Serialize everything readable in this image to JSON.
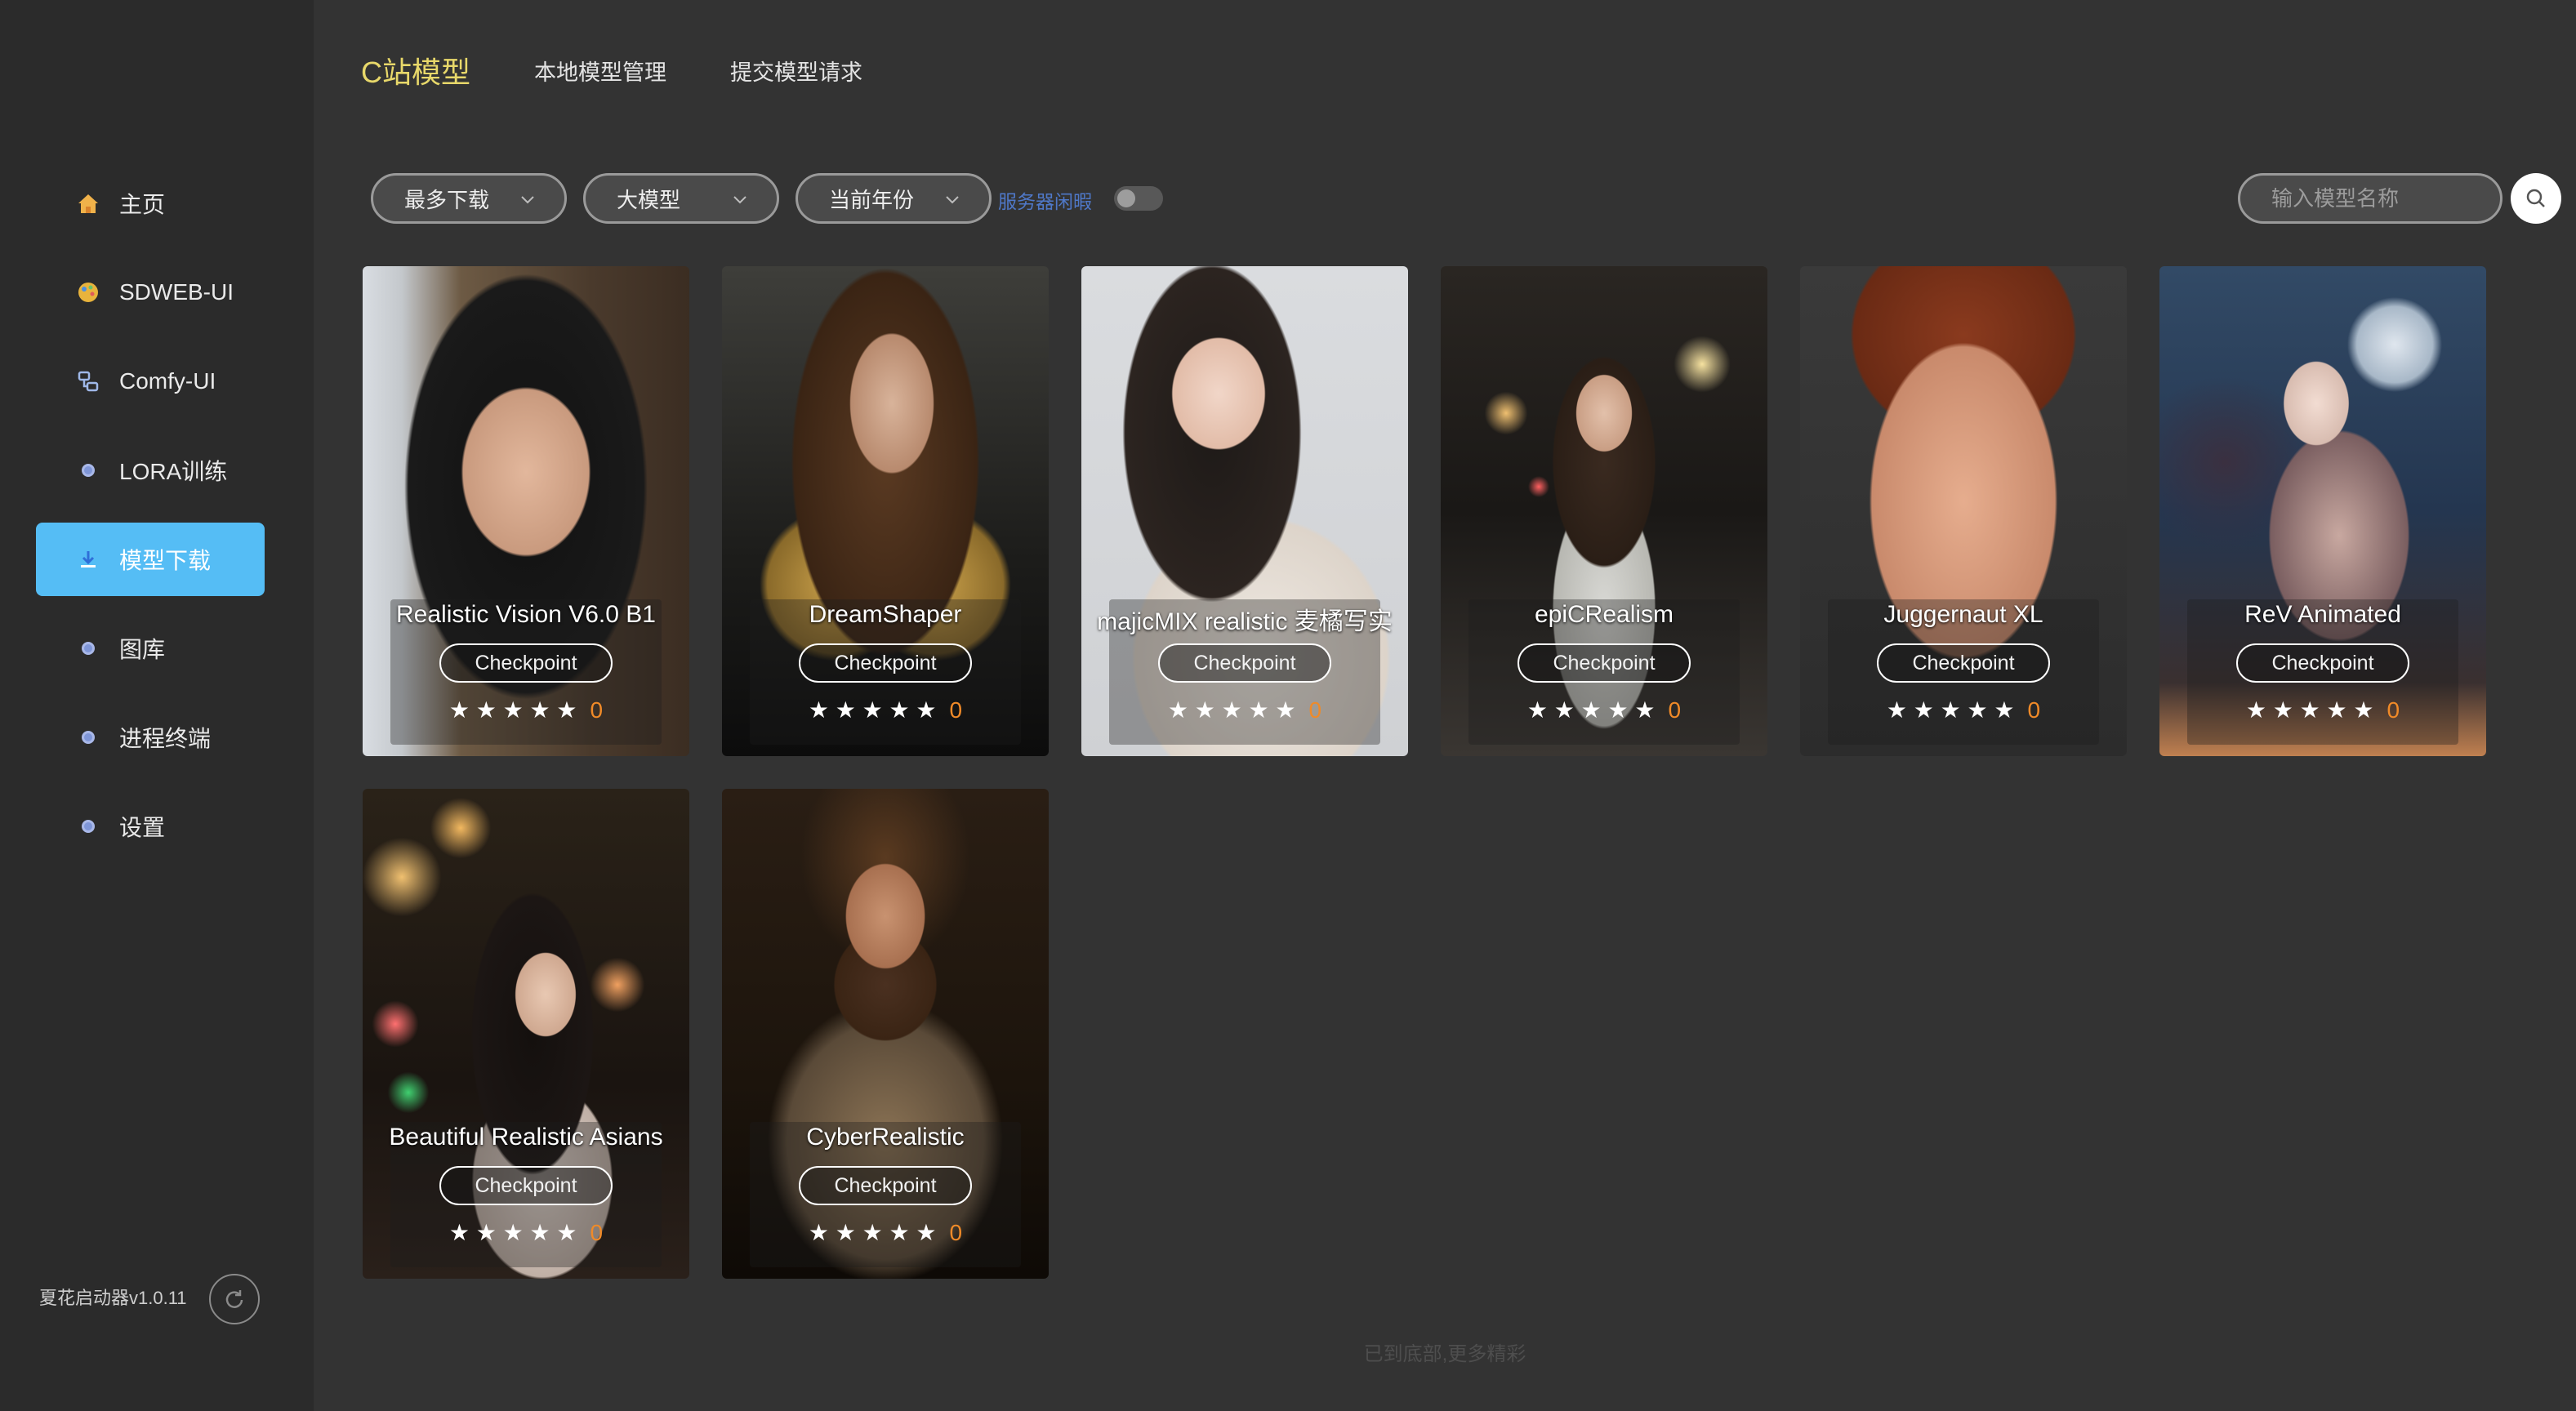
{
  "sidebar": {
    "items": [
      {
        "label": "主页",
        "icon": "home-icon",
        "active": false
      },
      {
        "label": "SDWEB-UI",
        "icon": "palette-icon",
        "active": false
      },
      {
        "label": "Comfy-UI",
        "icon": "workflow-icon",
        "active": false
      },
      {
        "label": "LORA训练",
        "icon": "dot-icon",
        "active": false
      },
      {
        "label": "模型下载",
        "icon": "download-icon",
        "active": true
      },
      {
        "label": "图库",
        "icon": "dot-icon",
        "active": false
      },
      {
        "label": "进程终端",
        "icon": "dot-icon",
        "active": false
      },
      {
        "label": "设置",
        "icon": "dot-icon",
        "active": false
      }
    ],
    "version": "夏花启动器v1.0.11"
  },
  "tabs": [
    {
      "label": "C站模型",
      "active": true
    },
    {
      "label": "本地模型管理",
      "active": false
    },
    {
      "label": "提交模型请求",
      "active": false
    }
  ],
  "filters": {
    "sort": "最多下载",
    "type": "大模型",
    "period": "当前年份",
    "server_label": "服务器闲暇",
    "server_toggle_on": false
  },
  "search": {
    "placeholder": "输入模型名称"
  },
  "models": [
    {
      "title": "Realistic Vision V6.0 B1",
      "tag": "Checkpoint",
      "stars": "★ ★ ★ ★ ★",
      "count": "0"
    },
    {
      "title": "DreamShaper",
      "tag": "Checkpoint",
      "stars": "★ ★ ★ ★ ★",
      "count": "0"
    },
    {
      "title": "majicMIX realistic 麦橘写实",
      "tag": "Checkpoint",
      "stars": "★ ★ ★ ★ ★",
      "count": "0"
    },
    {
      "title": "epiCRealism",
      "tag": "Checkpoint",
      "stars": "★ ★ ★ ★ ★",
      "count": "0"
    },
    {
      "title": "Juggernaut XL",
      "tag": "Checkpoint",
      "stars": "★ ★ ★ ★ ★",
      "count": "0"
    },
    {
      "title": "ReV Animated",
      "tag": "Checkpoint",
      "stars": "★ ★ ★ ★ ★",
      "count": "0"
    },
    {
      "title": "Beautiful Realistic Asians",
      "tag": "Checkpoint",
      "stars": "★ ★ ★ ★ ★",
      "count": "0"
    },
    {
      "title": "CyberRealistic",
      "tag": "Checkpoint",
      "stars": "★ ★ ★ ★ ★",
      "count": "0"
    }
  ],
  "footer": "已到底部,更多精彩",
  "colors": {
    "accent": "#55bdf5",
    "active_tab": "#e8d86a",
    "count": "#f08a28",
    "server_label": "#4f78c8"
  }
}
